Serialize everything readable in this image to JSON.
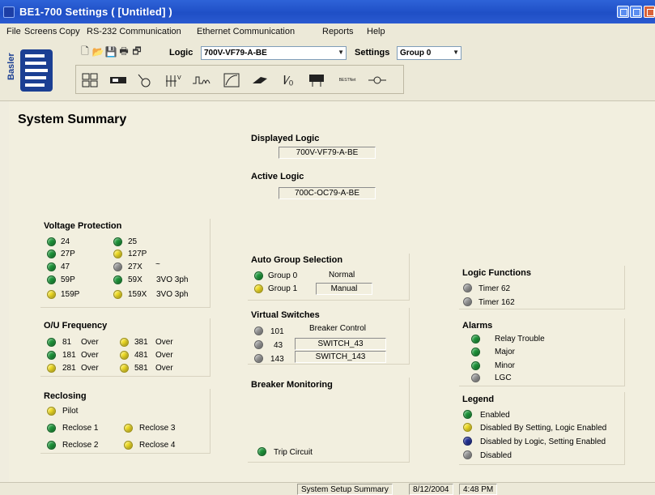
{
  "window": {
    "title": "BE1-700 Settings    ( [Untitled] )"
  },
  "menu": [
    "File",
    "Screens",
    "Copy",
    "RS-232 Communication",
    "Ethernet Communication",
    "Reports",
    "Help"
  ],
  "logo": {
    "vertical_text": "Basler"
  },
  "toolbar": {
    "logic_label": "Logic",
    "logic_value": "700V-VF79-A-BE",
    "settings_label": "Settings",
    "settings_value": "Group 0",
    "icon_text_1": "Ⅰ⁄₀",
    "icon_text_2": "BESTNet"
  },
  "page": {
    "title": "System Summary"
  },
  "displayed_logic": {
    "label": "Displayed Logic",
    "value": "700V-VF79-A-BE"
  },
  "active_logic": {
    "label": "Active Logic",
    "value": "700C-OC79-A-BE"
  },
  "voltage_protection": {
    "title": "Voltage Protection",
    "items": [
      {
        "label": "24",
        "state": "green"
      },
      {
        "label": "25",
        "state": "green"
      },
      {
        "label": "27P",
        "state": "green"
      },
      {
        "label": "127P",
        "state": "yellow"
      },
      {
        "label": "47",
        "state": "green"
      },
      {
        "label": "27X",
        "extra": "~",
        "state": "gray"
      },
      {
        "label": "59P",
        "state": "green"
      },
      {
        "label": "59X",
        "extra": "3VO 3ph",
        "state": "green"
      },
      {
        "label": "159P",
        "state": "yellow"
      },
      {
        "label": "159X",
        "extra": "3VO 3ph",
        "state": "yellow"
      }
    ]
  },
  "ou_frequency": {
    "title": "O/U Frequency",
    "items": [
      {
        "label": "81",
        "extra": "Over",
        "state": "green"
      },
      {
        "label": "381",
        "extra": "Over",
        "state": "yellow"
      },
      {
        "label": "181",
        "extra": "Over",
        "state": "green"
      },
      {
        "label": "481",
        "extra": "Over",
        "state": "yellow"
      },
      {
        "label": "281",
        "extra": "Over",
        "state": "yellow"
      },
      {
        "label": "581",
        "extra": "Over",
        "state": "yellow"
      }
    ]
  },
  "reclosing": {
    "title": "Reclosing",
    "items": [
      {
        "label": "Pilot",
        "state": "yellow"
      },
      {
        "label": "Reclose 1",
        "state": "green"
      },
      {
        "label": "Reclose 3",
        "state": "yellow"
      },
      {
        "label": "Reclose 2",
        "state": "green"
      },
      {
        "label": "Reclose 4",
        "state": "yellow"
      }
    ]
  },
  "auto_group": {
    "title": "Auto Group Selection",
    "items": [
      {
        "label": "Group 0",
        "value": "Normal",
        "state": "green"
      },
      {
        "label": "Group 1",
        "value": "Manual",
        "state": "yellow"
      }
    ]
  },
  "virtual_switches": {
    "title": "Virtual Switches",
    "header": "Breaker Control",
    "items": [
      {
        "label": "101",
        "value": "",
        "state": "gray"
      },
      {
        "label": "43",
        "value": "SWITCH_43",
        "state": "gray"
      },
      {
        "label": "143",
        "value": "SWITCH_143",
        "state": "gray"
      }
    ]
  },
  "breaker_monitoring": {
    "title": "Breaker Monitoring",
    "items": [
      {
        "label": "Trip Circuit",
        "state": "green"
      }
    ]
  },
  "logic_functions": {
    "title": "Logic Functions",
    "items": [
      {
        "label": "Timer 62",
        "state": "gray"
      },
      {
        "label": "Timer 162",
        "state": "gray"
      }
    ]
  },
  "alarms": {
    "title": "Alarms",
    "items": [
      {
        "label": "Relay Trouble",
        "state": "green"
      },
      {
        "label": "Major",
        "state": "green"
      },
      {
        "label": "Minor",
        "state": "green"
      },
      {
        "label": "LGC",
        "state": "gray"
      }
    ]
  },
  "legend": {
    "title": "Legend",
    "items": [
      {
        "label": "Enabled",
        "state": "green"
      },
      {
        "label": "Disabled By Setting, Logic Enabled",
        "state": "yellow"
      },
      {
        "label": "Disabled by Logic, Setting Enabled",
        "state": "blue"
      },
      {
        "label": "Disabled",
        "state": "gray"
      }
    ]
  },
  "colors": {
    "green": "#1e9a3b",
    "yellow": "#f4e025",
    "gray": "#9a9a9a",
    "blue": "#23329a",
    "titlebar": "#1f4fc6"
  },
  "status": {
    "screen": "System Setup Summary",
    "date": "8/12/2004",
    "time": "4:48 PM"
  }
}
